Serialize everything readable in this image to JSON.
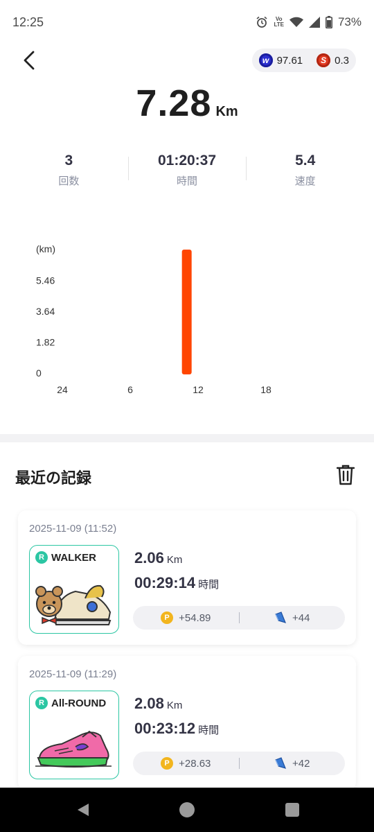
{
  "status": {
    "time": "12:25",
    "battery": "73%",
    "lte_top": "Vo",
    "lte_bottom": "LTE"
  },
  "header": {
    "tokens": [
      {
        "icon": "w-token-icon",
        "value": "97.61"
      },
      {
        "icon": "s-token-icon",
        "value": "0.3"
      }
    ]
  },
  "summary": {
    "distance": "7.28",
    "unit": "Km"
  },
  "stats": [
    {
      "value": "3",
      "label": "回数"
    },
    {
      "value": "01:20:37",
      "label": "時間"
    },
    {
      "value": "5.4",
      "label": "速度"
    }
  ],
  "chart_data": {
    "type": "bar",
    "y_unit_label": "(km)",
    "yticks": [
      "0",
      "1.82",
      "3.64",
      "5.46"
    ],
    "ylim": [
      0,
      7.28
    ],
    "xticks": [
      "24",
      "6",
      "12",
      "18"
    ],
    "x": [
      11
    ],
    "values": [
      7.28
    ],
    "color": "#ff4500"
  },
  "records_title": "最近の記録",
  "records": [
    {
      "date": "2025-11-09 (11:52)",
      "shoe_type": "WALKER",
      "rarity": "R",
      "distance": "2.06",
      "distance_unit": "Km",
      "time": "00:29:14",
      "time_unit": "時間",
      "points": "+54.89",
      "gems": "+44",
      "art": "bear"
    },
    {
      "date": "2025-11-09 (11:29)",
      "shoe_type": "All-ROUND",
      "rarity": "R",
      "distance": "2.08",
      "distance_unit": "Km",
      "time": "00:23:12",
      "time_unit": "時間",
      "points": "+28.63",
      "gems": "+42",
      "art": "sneaker"
    }
  ],
  "colors": {
    "accent_teal": "#2bc6a3",
    "bar_orange": "#ff4500",
    "point_coin": "#f2b51e"
  },
  "point_icon_letter": "P",
  "nav": {
    "back": "back-icon",
    "home": "home-icon",
    "recents": "recents-icon"
  }
}
